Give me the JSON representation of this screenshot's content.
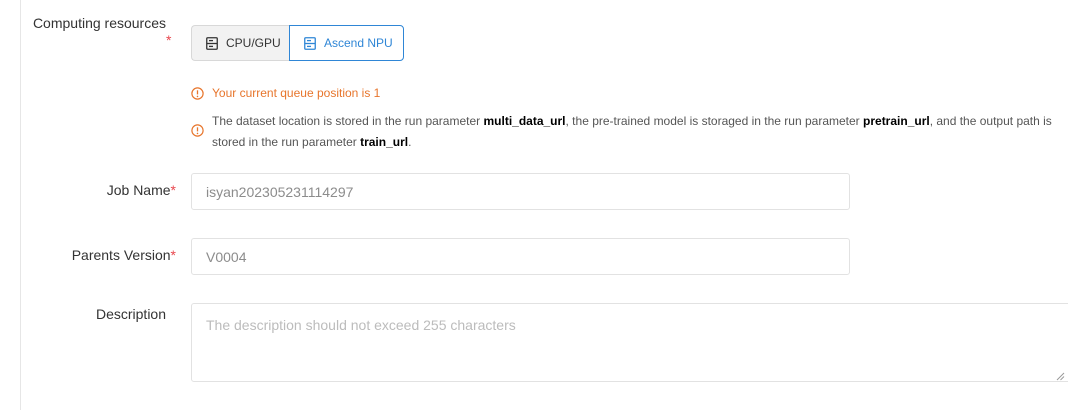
{
  "form": {
    "computing_resources": {
      "label": "Computing resources",
      "required_mark": "*",
      "options": [
        {
          "label": "CPU/GPU",
          "selected": false,
          "icon": "server-icon"
        },
        {
          "label": "Ascend NPU",
          "selected": true,
          "icon": "server-icon"
        }
      ]
    },
    "notices": {
      "queue": {
        "text": "Your current queue position is 1",
        "icon": "warning-circle-icon",
        "color": "#e7752c"
      },
      "params": {
        "part1": "The dataset location is stored in the run parameter ",
        "param1": "multi_data_url",
        "part2": ", the pre-trained model is storaged in the run parameter ",
        "param2": "pretrain_url",
        "part3": ", and the output path is stored in the run parameter ",
        "param3": "train_url",
        "part4": ".",
        "icon": "warning-circle-icon",
        "color": "#e7752c"
      }
    },
    "job_name": {
      "label": "Job Name",
      "required_mark": "*",
      "value": "isyan202305231114297"
    },
    "parents_version": {
      "label": "Parents Version",
      "required_mark": "*",
      "value": "V0004"
    },
    "description": {
      "label": "Description",
      "placeholder": "The description should not exceed 255 characters"
    }
  },
  "colors": {
    "accent": "#2f86d6",
    "required": "#e8464d",
    "warning": "#e7752c"
  }
}
